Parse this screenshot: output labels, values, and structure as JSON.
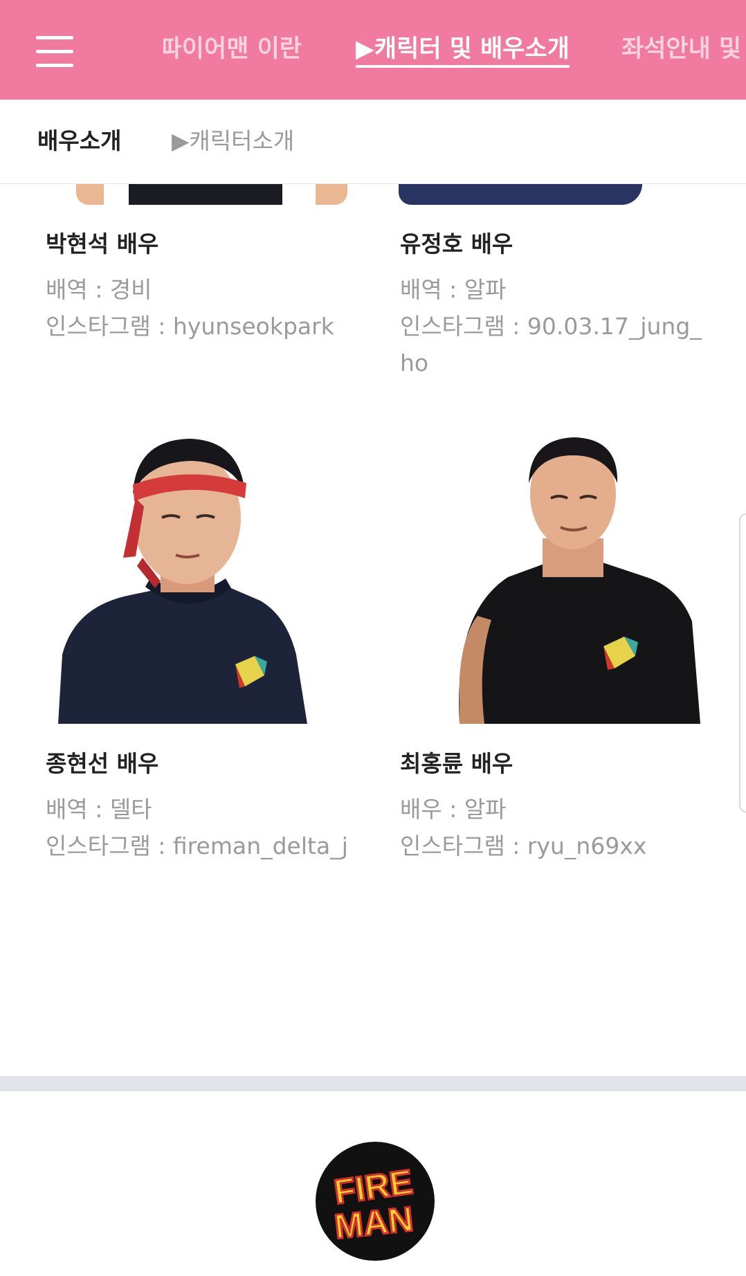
{
  "header": {
    "menu_icon": "hamburger-menu-icon",
    "tabs": [
      {
        "label": "파이어맨 이란?",
        "state": "inactive"
      },
      {
        "label": "▶캐릭터 및 배우소개",
        "state": "active"
      },
      {
        "label": "좌석안내 및",
        "state": "inactive"
      }
    ],
    "background_color": "#f07aa0"
  },
  "subnav": {
    "current": "배우소개",
    "link": "▶캐릭터소개"
  },
  "actors": [
    {
      "name": "박현석 배우",
      "role": "배역 : 경비",
      "instagram": "인스타그램 : hyunseokpark"
    },
    {
      "name": "유정호 배우",
      "role": "배역 : 알파",
      "instagram": "인스타그램 : 90.03.17_jung_ho"
    },
    {
      "name": "종현선 배우",
      "role": "배역 : 델타",
      "instagram": "인스타그램 : fireman_delta_j"
    },
    {
      "name": "최홍륜 배우",
      "role": "배우 : 알파",
      "instagram": "인스타그램 : ryu_n69xx"
    }
  ],
  "footer": {
    "logo_text_line1": "FIRE",
    "logo_text_line2": "MAN",
    "logo_icon": "fireman-logo-icon"
  }
}
